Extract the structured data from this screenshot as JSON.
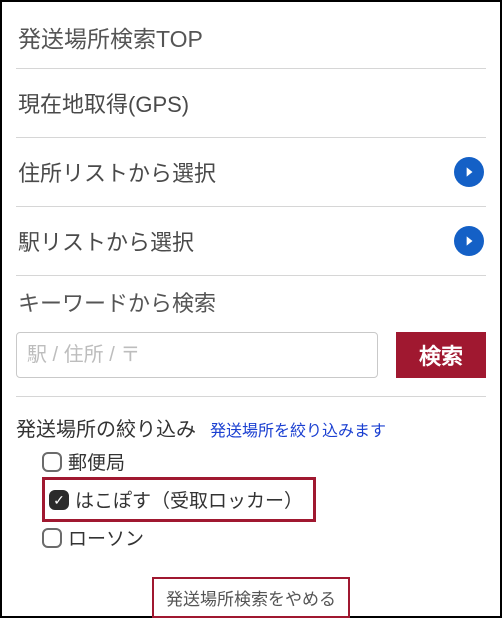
{
  "header": {
    "title": "発送場所検索TOP"
  },
  "nav": {
    "gps": "現在地取得(GPS)",
    "address_list": "住所リストから選択",
    "station_list": "駅リストから選択"
  },
  "keyword": {
    "heading": "キーワードから検索",
    "placeholder": "駅 / 住所 / 〒",
    "button": "検索"
  },
  "filter": {
    "title": "発送場所の絞り込み",
    "note": "発送場所を絞り込みます",
    "options": {
      "post_office": {
        "label": "郵便局",
        "checked": false
      },
      "hakoposu": {
        "label": "はこぽす（受取ロッカー）",
        "checked": true
      },
      "lawson": {
        "label": "ローソン",
        "checked": false
      }
    }
  },
  "cancel": {
    "label": "発送場所検索をやめる"
  }
}
